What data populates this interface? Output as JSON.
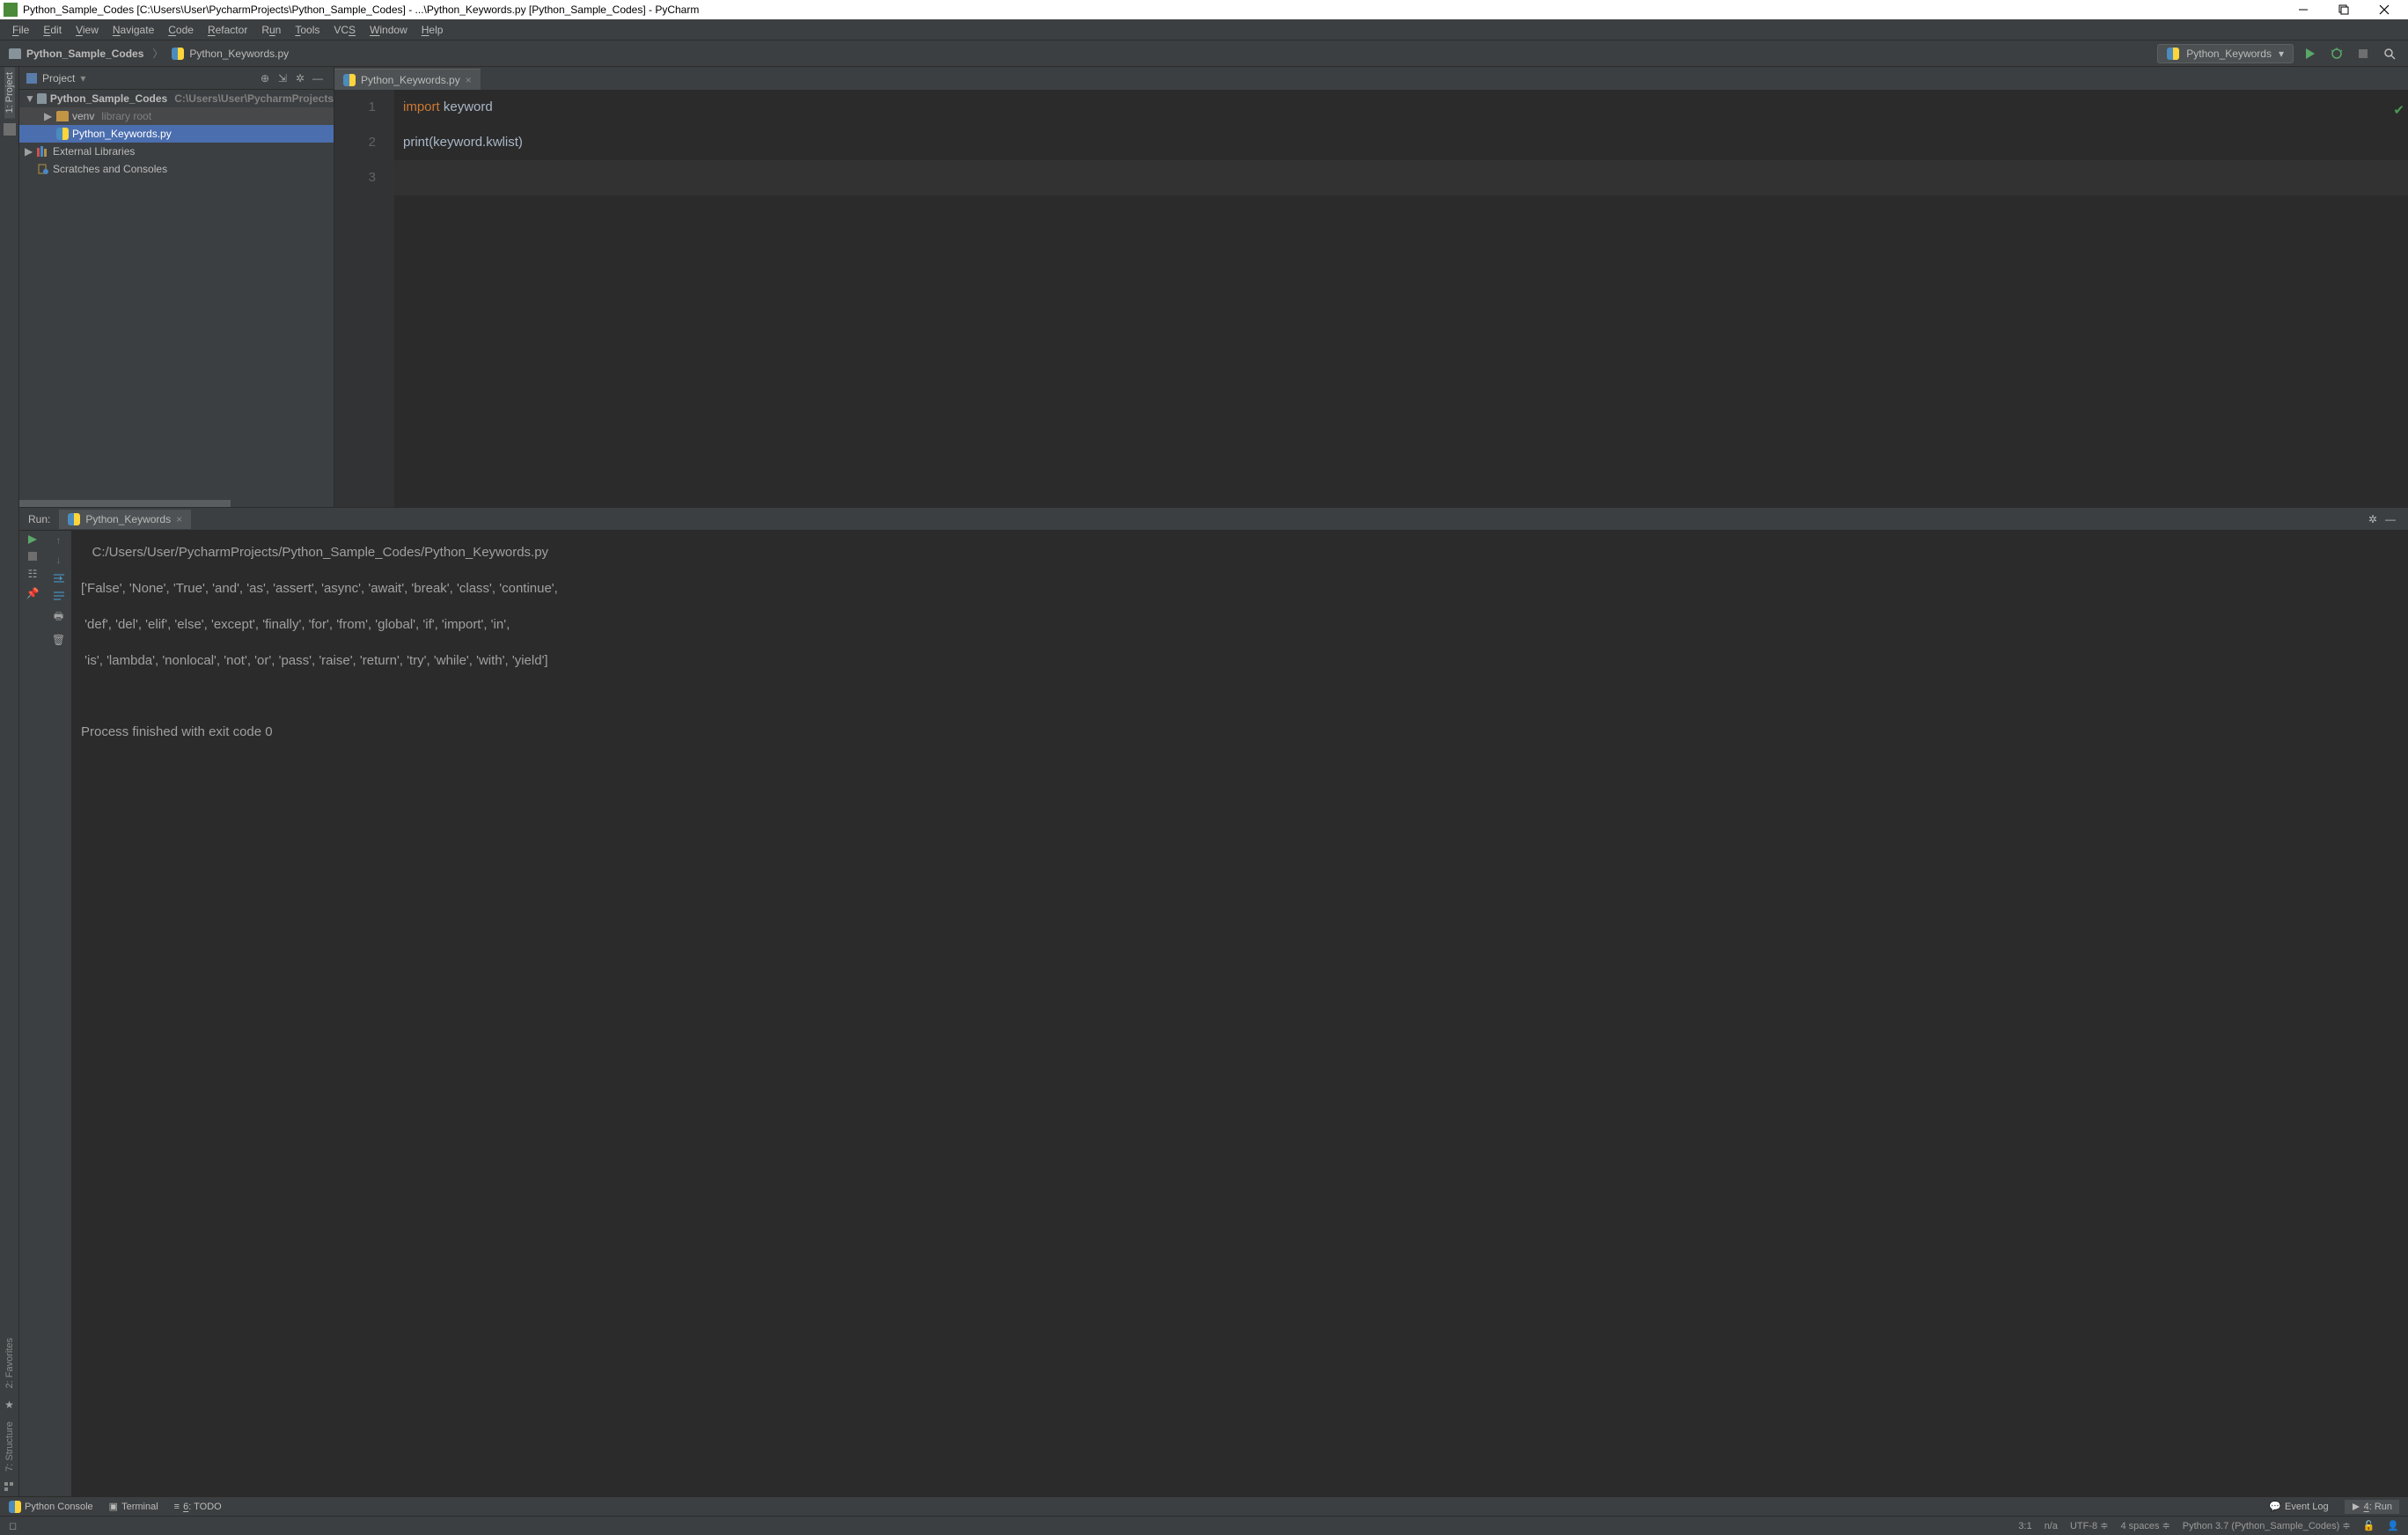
{
  "titlebar": {
    "text": "Python_Sample_Codes [C:\\Users\\User\\PycharmProjects\\Python_Sample_Codes] - ...\\Python_Keywords.py [Python_Sample_Codes] - PyCharm"
  },
  "menu": {
    "items": [
      "File",
      "Edit",
      "View",
      "Navigate",
      "Code",
      "Refactor",
      "Run",
      "Tools",
      "VCS",
      "Window",
      "Help"
    ]
  },
  "breadcrumb": {
    "project": "Python_Sample_Codes",
    "file": "Python_Keywords.py"
  },
  "runconfig": {
    "selected": "Python_Keywords"
  },
  "project_panel": {
    "title": "Project",
    "tree": {
      "root_name": "Python_Sample_Codes",
      "root_path": "C:\\Users\\User\\PycharmProjects",
      "venv_name": "venv",
      "venv_hint": "library root",
      "file_name": "Python_Keywords.py",
      "ext_libs": "External Libraries",
      "scratches": "Scratches and Consoles"
    }
  },
  "left_tabs": {
    "project": "1: Project",
    "favorites": "2: Favorites",
    "structure": "7: Structure"
  },
  "editor": {
    "tab_name": "Python_Keywords.py",
    "lines": [
      "1",
      "2",
      "3"
    ],
    "code_import": "import",
    "code_keyword": " keyword",
    "code_print": "print",
    "code_rest": "(keyword.kwlist)"
  },
  "run": {
    "label": "Run:",
    "tab": "Python_Keywords",
    "output_path": "   C:/Users/User/PycharmProjects/Python_Sample_Codes/Python_Keywords.py",
    "output_l1": "['False', 'None', 'True', 'and', 'as', 'assert', 'async', 'await', 'break', 'class', 'continue', ",
    "output_l2": " 'def', 'del', 'elif', 'else', 'except', 'finally', 'for', 'from', 'global', 'if', 'import', 'in', ",
    "output_l3": " 'is', 'lambda', 'nonlocal', 'not', 'or', 'pass', 'raise', 'return', 'try', 'while', 'with', 'yield']",
    "output_exit": "Process finished with exit code 0"
  },
  "bottom": {
    "python_console": "Python Console",
    "terminal": "Terminal",
    "todo": "6: TODO",
    "event_log": "Event Log",
    "run_btn": "4: Run"
  },
  "status": {
    "pos": "3:1",
    "na": "n/a",
    "encoding": "UTF-8",
    "indent": "4 spaces",
    "interpreter": "Python 3.7 (Python_Sample_Codes)"
  }
}
